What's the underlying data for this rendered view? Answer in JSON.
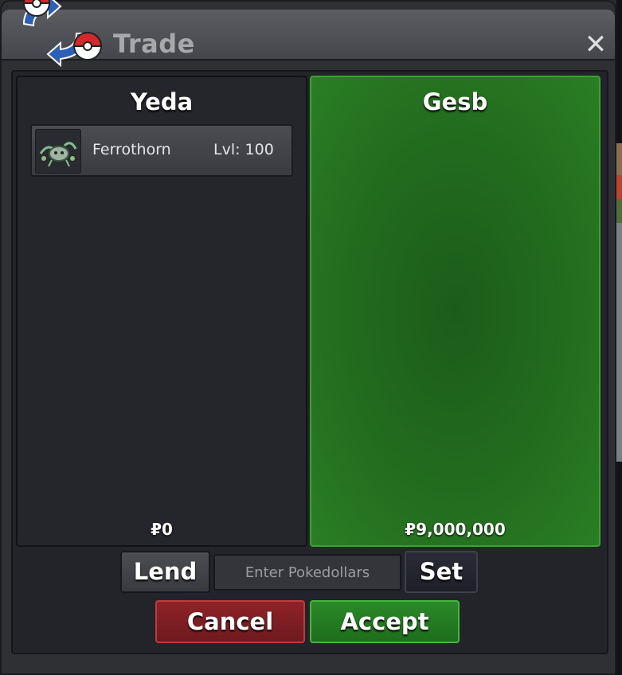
{
  "window": {
    "title": "Trade",
    "close_label": "✕"
  },
  "trade": {
    "left": {
      "player_name": "Yeda",
      "money": "₽0",
      "items": [
        {
          "name": "Ferrothorn",
          "level": "Lvl: 100",
          "icon": "ferrothorn-sprite-icon"
        }
      ]
    },
    "right": {
      "player_name": "Gesb",
      "money": "₽9,000,000",
      "accepted": true
    }
  },
  "controls": {
    "lend_label": "Lend",
    "money_placeholder": "Enter Pokedollars",
    "set_label": "Set",
    "cancel_label": "Cancel",
    "accept_label": "Accept"
  },
  "colors": {
    "accept_green": "#2a8a28",
    "cancel_red": "#8e2328",
    "accepted_panel": "#236e1f"
  }
}
